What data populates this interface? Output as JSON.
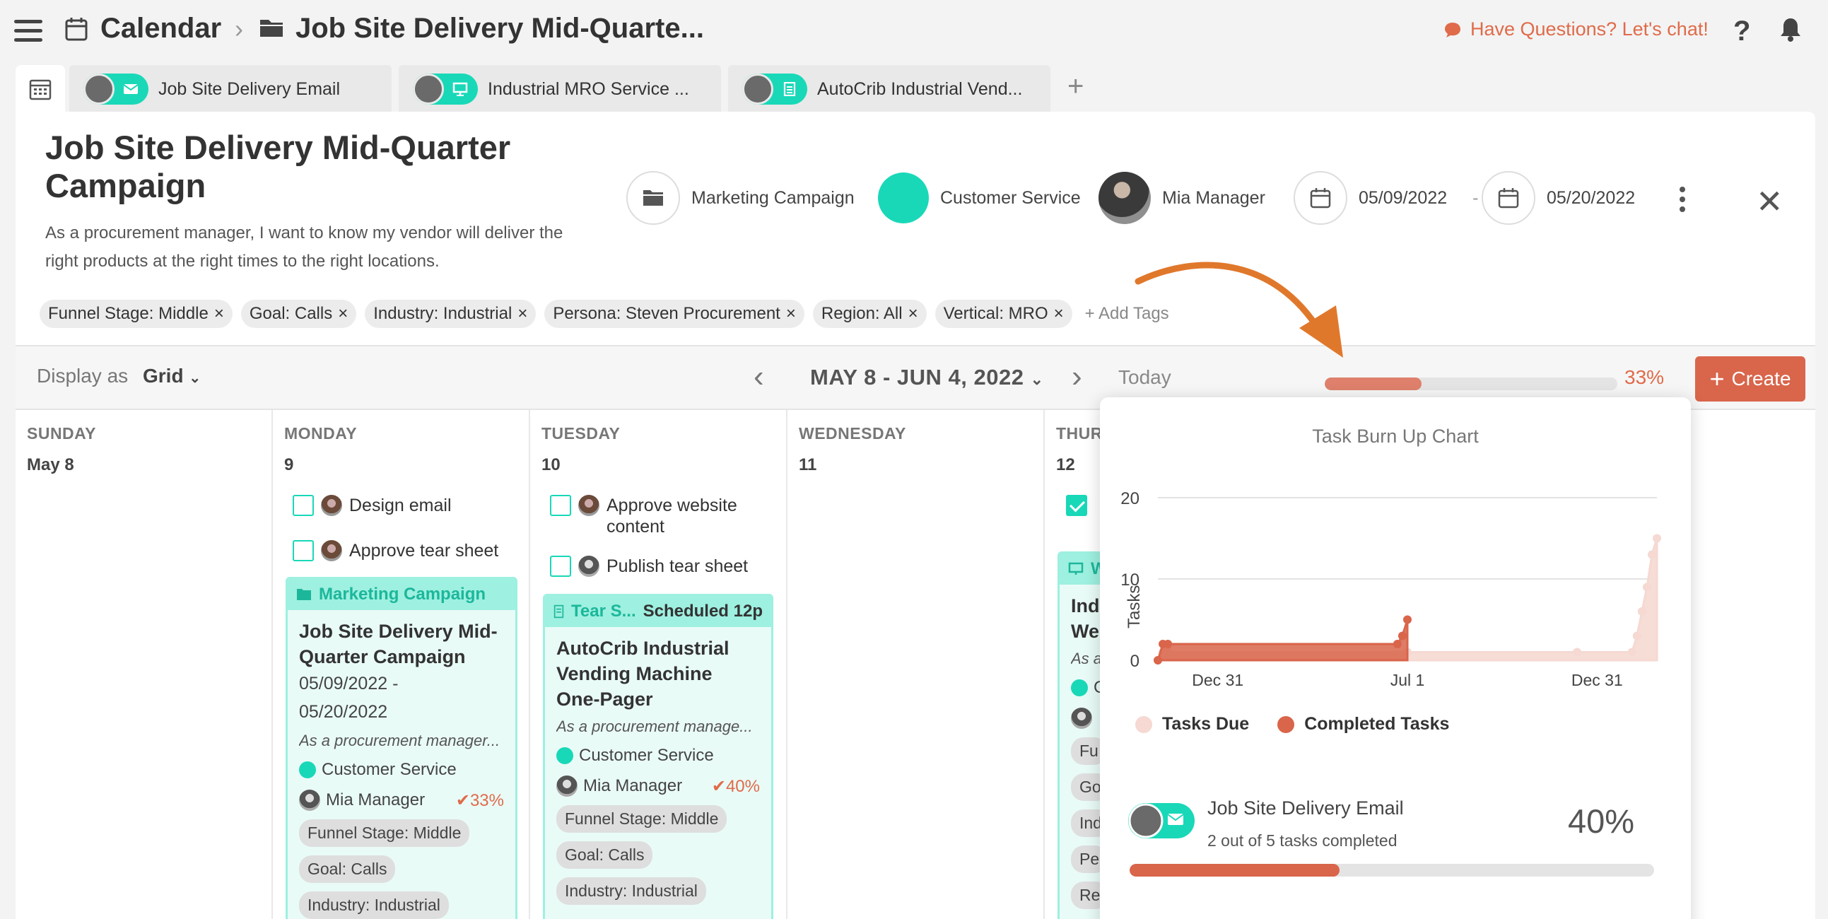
{
  "breadcrumb": {
    "root": "Calendar",
    "current": "Job Site Delivery Mid-Quarte..."
  },
  "help": {
    "chat_label": "Have Questions? Let's chat!"
  },
  "tabs": [
    {
      "label": "Job Site Delivery Email",
      "icon": "email-icon"
    },
    {
      "label": "Industrial MRO Service ...",
      "icon": "monitor-icon"
    },
    {
      "label": "AutoCrib Industrial Vend...",
      "icon": "document-icon"
    }
  ],
  "campaign": {
    "title": "Job Site Delivery Mid-Quarter Campaign",
    "description": "As a procurement manager, I want to know my vendor will deliver the right products at the right times to the right locations.",
    "type": "Marketing Campaign",
    "team": "Customer Service",
    "owner": "Mia Manager",
    "start_date": "05/09/2022",
    "date_sep": "-",
    "end_date": "05/20/2022",
    "tags": [
      "Funnel Stage: Middle",
      "Goal: Calls",
      "Industry: Industrial",
      "Persona: Steven Procurement",
      "Region: All",
      "Vertical: MRO"
    ],
    "add_tags": "+ Add Tags"
  },
  "toolbar": {
    "display_as": "Display as",
    "view": "Grid",
    "date_range": "MAY 8 - JUN 4, 2022",
    "today": "Today",
    "progress": 0.33,
    "progress_label": "33%",
    "create": "Create"
  },
  "days": [
    {
      "name": "SUNDAY",
      "num": "May 8"
    },
    {
      "name": "MONDAY",
      "num": "9"
    },
    {
      "name": "TUESDAY",
      "num": "10"
    },
    {
      "name": "WEDNESDAY",
      "num": "11"
    },
    {
      "name": "THUR",
      "num": "12"
    }
  ],
  "monday": {
    "tasks": [
      "Design email",
      "Approve tear sheet"
    ],
    "card": {
      "header": "Marketing Campaign",
      "title": "Job Site Delivery Mid-Quarter Campaign",
      "date_start": "05/09/2022 -",
      "date_end": "05/20/2022",
      "desc": "As a procurement manager...",
      "team": "Customer Service",
      "owner": "Mia Manager",
      "pct": "33%",
      "tags": [
        "Funnel Stage: Middle",
        "Goal: Calls",
        "Industry: Industrial"
      ]
    }
  },
  "tuesday": {
    "tasks": [
      "Approve website content",
      "Publish tear sheet"
    ],
    "card": {
      "header": "Tear S...",
      "status": "Scheduled 12p",
      "title": "AutoCrib Industrial Vending Machine One-Pager",
      "desc": "As a procurement manage...",
      "team": "Customer Service",
      "owner": "Mia Manager",
      "pct": "40%",
      "tags": [
        "Funnel Stage: Middle",
        "Goal: Calls",
        "Industry: Industrial"
      ]
    }
  },
  "thursday": {
    "card_header": "W",
    "card_title": "Indu Wel",
    "card_desc": "As a",
    "team_initial": "C",
    "tags": [
      "Fu",
      "Go",
      "Ind",
      "Pe",
      "Re"
    ]
  },
  "popover": {
    "item_name": "Job Site Delivery Email",
    "item_sub": "2 out of 5 tasks completed",
    "item_pct": "40%",
    "item_progress": 0.4
  },
  "chart_data": {
    "type": "area",
    "title": "Task Burn Up Chart",
    "ylabel": "Tasks",
    "xlabel": "",
    "xticks": [
      "Dec 31",
      "Jul 1",
      "Dec 31"
    ],
    "yticks": [
      0,
      10,
      20
    ],
    "ylim": [
      0,
      20
    ],
    "xlim": [
      0,
      100
    ],
    "legend_position": "bottom",
    "series": [
      {
        "name": "Tasks Due",
        "color": "#f5d9d2",
        "x": [
          0,
          1,
          2,
          50,
          84,
          95,
          96,
          97,
          98,
          99,
          100
        ],
        "y": [
          0,
          1,
          1,
          1,
          1,
          1,
          3,
          6,
          9,
          13,
          15
        ]
      },
      {
        "name": "Completed Tasks",
        "color": "#d9654b",
        "x": [
          0,
          1,
          2,
          48,
          49,
          50
        ],
        "y": [
          0,
          2,
          2,
          2,
          3,
          5
        ]
      }
    ]
  },
  "colors": {
    "accent": "#d9654b",
    "teal": "#19d8b8",
    "teal_light": "#9ef0e0"
  }
}
